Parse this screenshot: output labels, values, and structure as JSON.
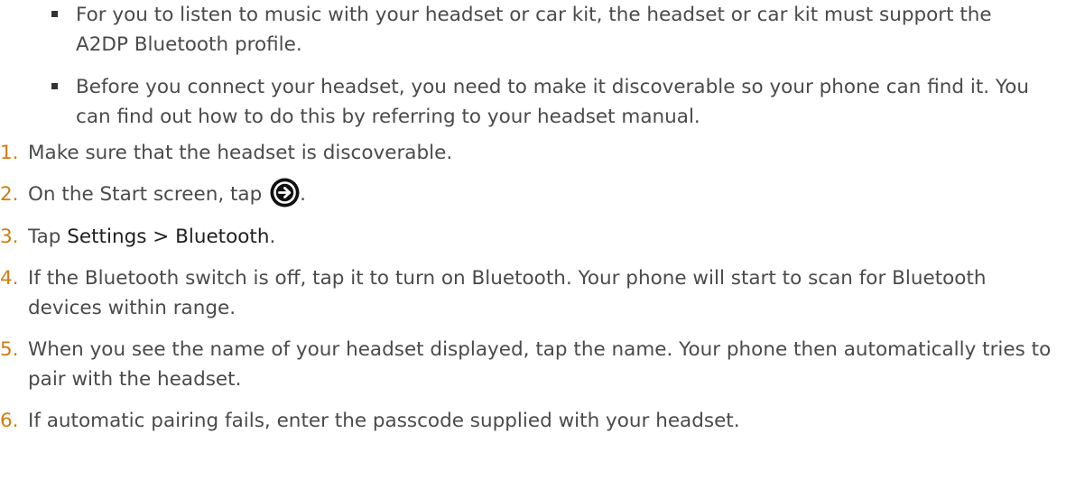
{
  "bullets": [
    "For you to listen to music with your headset or car kit, the headset or car kit must support the A2DP Bluetooth profile.",
    "Before you connect your headset, you need to make it discoverable so your phone can find it. You can find out how to do this by referring to your headset manual."
  ],
  "steps": {
    "s1": {
      "num": "1.",
      "text": "Make sure that the headset is discoverable."
    },
    "s2": {
      "num": "2.",
      "text_before": "On the Start screen, tap ",
      "text_after": ".",
      "icon": "arrow-right-circle-icon"
    },
    "s3": {
      "num": "3.",
      "text_before": "Tap ",
      "term": "Settings > Bluetooth",
      "text_after": "."
    },
    "s4": {
      "num": "4.",
      "text": "If the Bluetooth switch is off, tap it to turn on Bluetooth. Your phone will start to scan for Bluetooth devices within range."
    },
    "s5": {
      "num": "5.",
      "text": "When you see the name of your headset displayed, tap the name. Your phone then automatically tries to pair with the headset."
    },
    "s6": {
      "num": "6.",
      "text": "If automatic pairing fails, enter the passcode supplied with your headset."
    }
  },
  "colors": {
    "step_number": "#d27d10",
    "body_text": "#4a4a4a",
    "icon_fill": "#111111"
  }
}
